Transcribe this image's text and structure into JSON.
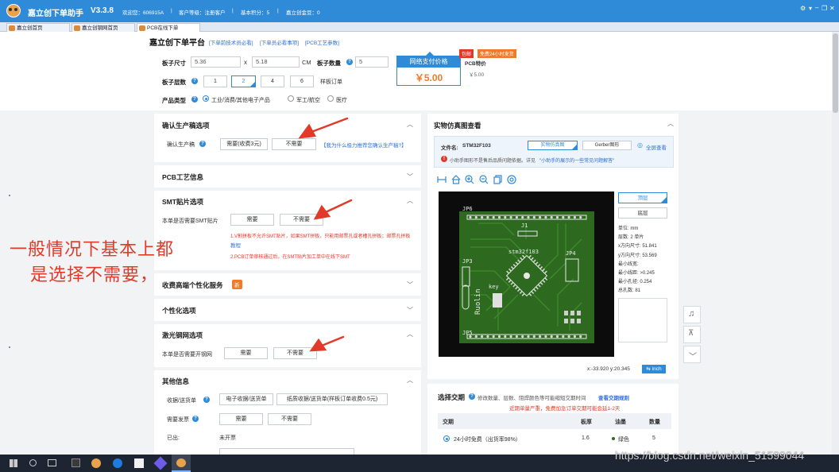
{
  "titlebar": {
    "app_name": "嘉立创下单助手",
    "version": "V3.3.8",
    "welcome": "欢迎您：606915A",
    "sep1": "|",
    "level": "客户等级：注册客户",
    "sep2": "|",
    "points": "基本积分：5",
    "sep3": "|",
    "coins": "嘉立创金豆：0",
    "controls": [
      "⚙",
      "▾",
      "‒",
      "❐",
      "✕"
    ]
  },
  "tabs": [
    {
      "label": "嘉立创首页"
    },
    {
      "label": "嘉立创钢网首页"
    },
    {
      "label": "PCB在线下单"
    }
  ],
  "platform": {
    "title": "嘉立创下单平台",
    "links": [
      "[下单前技术员必看]",
      "[下单员必看事项]",
      "[PCB工艺参数]"
    ]
  },
  "board": {
    "size_label": "板子尺寸",
    "width": "5.36",
    "times": "x",
    "height": "5.18",
    "unit": "CM",
    "qty_label": "板子数量",
    "qty": "5",
    "layers_label": "板子层数",
    "layer_options": [
      "1",
      "2",
      "4",
      "6"
    ],
    "sample_label": "样板订单",
    "type_label": "产品类型",
    "type_options": [
      "工业/消费/其他电子产品",
      "军工/航空",
      "医疗"
    ]
  },
  "price": {
    "header": "网络支付价格",
    "value": "￥5.00",
    "tag1": "包邮",
    "tag2": "免费24小时发货",
    "pcb_price_label": "PCB特价",
    "pcb_price": "￥5.00"
  },
  "sections": {
    "confirm": {
      "title": "确认生产稿选项",
      "row_label": "确认生产稿",
      "opt_yes": "需要(收费3元)",
      "opt_no": "不需要",
      "link": "【我为什么极力推荐您确认生产稿?】"
    },
    "pcb_process": {
      "title": "PCB工艺信息"
    },
    "smt": {
      "title": "SMT贴片选项",
      "row_label": "本单是否需要SMT贴片",
      "opt_yes": "需要",
      "opt_no": "不需要",
      "note1": "1.V割拼板不允许SMT贴片，如果SMT拼板，只能用邮票孔或者槽孔拼板；邮票孔拼板",
      "note1_link": "教程",
      "note2": "2.PCB订单审核通过后，在SMT贴片加工单中在线下SMT"
    },
    "paid": {
      "title": "收费高端个性化服务",
      "badge": "新"
    },
    "custom": {
      "title": "个性化选项"
    },
    "stencil": {
      "title": "激光钢网选项",
      "row_label": "本单是否需要开钢网",
      "opt_yes": "需要",
      "opt_no": "不需要"
    },
    "other": {
      "title": "其他信息",
      "receipt_label": "收据/送货单",
      "receipt_opt1": "电子收据/送货单",
      "receipt_opt2": "纸质收据/送货单(样板订单收费0.5元)",
      "invoice_label": "需要发票",
      "invoice_yes": "需要",
      "invoice_no": "不需要",
      "opened_label": "已出:",
      "opened_value": "未开票"
    }
  },
  "annotation": {
    "line1": "一般情况下基本上都",
    "line2": "是选择不需要，"
  },
  "viewer": {
    "title": "实物仿真图查看",
    "file_label": "文件名:",
    "file_name": "STM32F103",
    "btn_real": "实物仿真图",
    "btn_gerber": "Gerber图形",
    "fullscreen": "全屏查看",
    "warning": "小助手图形不是售后品质问题依据。详见",
    "warning_link": "\"小助手的展示的一些常见问题解答\"",
    "top_layer": "顶层",
    "bottom_layer": "底层",
    "coords": "x:-33.920 y:20.345",
    "unit_btn": "inch",
    "pcb_text": {
      "jp6": "JP6",
      "jp3": "JP3",
      "jp5": "JP5",
      "jp4": "JP4",
      "j1": "J1",
      "chip": "stm32f103",
      "key": "key",
      "brand": "Ruolin"
    },
    "specs": [
      {
        "k": "单位:",
        "v": "mm"
      },
      {
        "k": "层数:",
        "v": "2  单片"
      },
      {
        "k": "x方向尺寸:",
        "v": "51.841"
      },
      {
        "k": "y方向尺寸:",
        "v": "53.569"
      },
      {
        "k": "最小线宽:",
        "v": ""
      },
      {
        "k": "最小线距:",
        "v": ">0.245"
      },
      {
        "k": "最小孔径:",
        "v": "0.254"
      },
      {
        "k": "总孔数:",
        "v": "81"
      }
    ]
  },
  "delivery": {
    "title": "选择交期",
    "desc": "修改数量、层数、阻焊颜色等可能缩短交期时间",
    "link": "查看交期规则",
    "warning": "近期单量严重，免费加急订单交期可能会延1-2天",
    "headers": [
      "交期",
      "板厚",
      "油墨",
      "数量"
    ],
    "row": {
      "label": "24小时免费（出货率98%）",
      "thickness": "1.6",
      "ink": "绿色",
      "qty": "5"
    }
  },
  "side_buttons": [
    "headset-icon",
    "to-top-icon",
    "collapse-icon"
  ],
  "watermark": "https://blog.csdn.net/weixin_51599044",
  "colors": {
    "primary": "#2f8ad8",
    "red": "#e23a2a",
    "pcb_green": "#2d6a1f",
    "orange": "#f07a2a"
  }
}
